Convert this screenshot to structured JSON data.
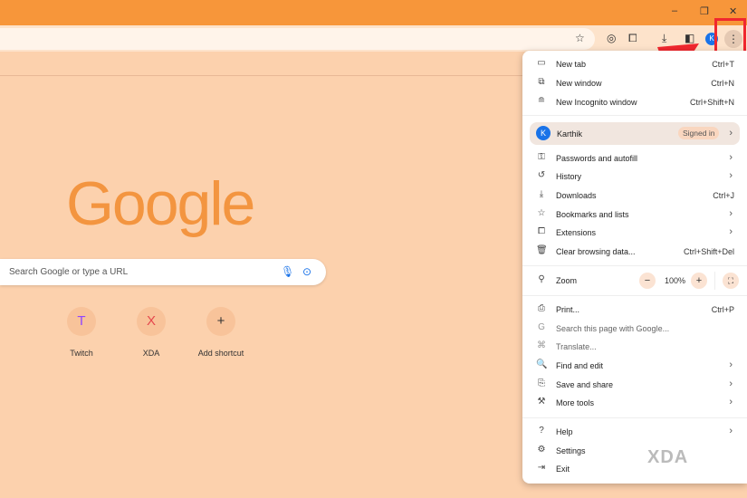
{
  "window": {
    "minimize": "–",
    "restore": "❐",
    "close": "✕"
  },
  "toolbar": {
    "profile_initial": "K"
  },
  "page": {
    "logo": "Google",
    "search_placeholder": "Search Google or type a URL",
    "shortcuts": [
      {
        "label": "Twitch",
        "icon": "T"
      },
      {
        "label": "XDA",
        "icon": "X"
      },
      {
        "label": "Add shortcut",
        "icon": "+"
      }
    ]
  },
  "menu": {
    "group1": [
      {
        "label": "New tab",
        "shortcut": "Ctrl+T",
        "icon": "▭"
      },
      {
        "label": "New window",
        "shortcut": "Ctrl+N",
        "icon": "⧉"
      },
      {
        "label": "New Incognito window",
        "shortcut": "Ctrl+Shift+N",
        "icon": "≘"
      }
    ],
    "account": {
      "initial": "K",
      "name": "Karthik",
      "status": "Signed in"
    },
    "group2": [
      {
        "label": "Passwords and autofill",
        "icon": "⚿"
      },
      {
        "label": "History",
        "icon": "↺"
      },
      {
        "label": "Downloads",
        "shortcut": "Ctrl+J",
        "icon": "⤓"
      },
      {
        "label": "Bookmarks and lists",
        "icon": "☆"
      },
      {
        "label": "Extensions",
        "icon": "⧠"
      },
      {
        "label": "Clear browsing data...",
        "shortcut": "Ctrl+Shift+Del",
        "icon": "🗑"
      }
    ],
    "zoom": {
      "label": "Zoom",
      "value": "100%",
      "minus": "−",
      "plus": "+",
      "fullscreen": "⛶"
    },
    "group3": [
      {
        "label": "Print...",
        "shortcut": "Ctrl+P",
        "icon": "⎙"
      },
      {
        "label": "Search this page with Google...",
        "icon": "G"
      },
      {
        "label": "Translate...",
        "icon": "⌘"
      },
      {
        "label": "Find and edit",
        "icon": "🔍"
      },
      {
        "label": "Save and share",
        "icon": "⎘"
      },
      {
        "label": "More tools",
        "icon": "⚒"
      }
    ],
    "group4": [
      {
        "label": "Help",
        "icon": "?"
      },
      {
        "label": "Settings",
        "icon": "⚙"
      },
      {
        "label": "Exit",
        "icon": "⇥"
      }
    ]
  },
  "watermark": "XDA"
}
